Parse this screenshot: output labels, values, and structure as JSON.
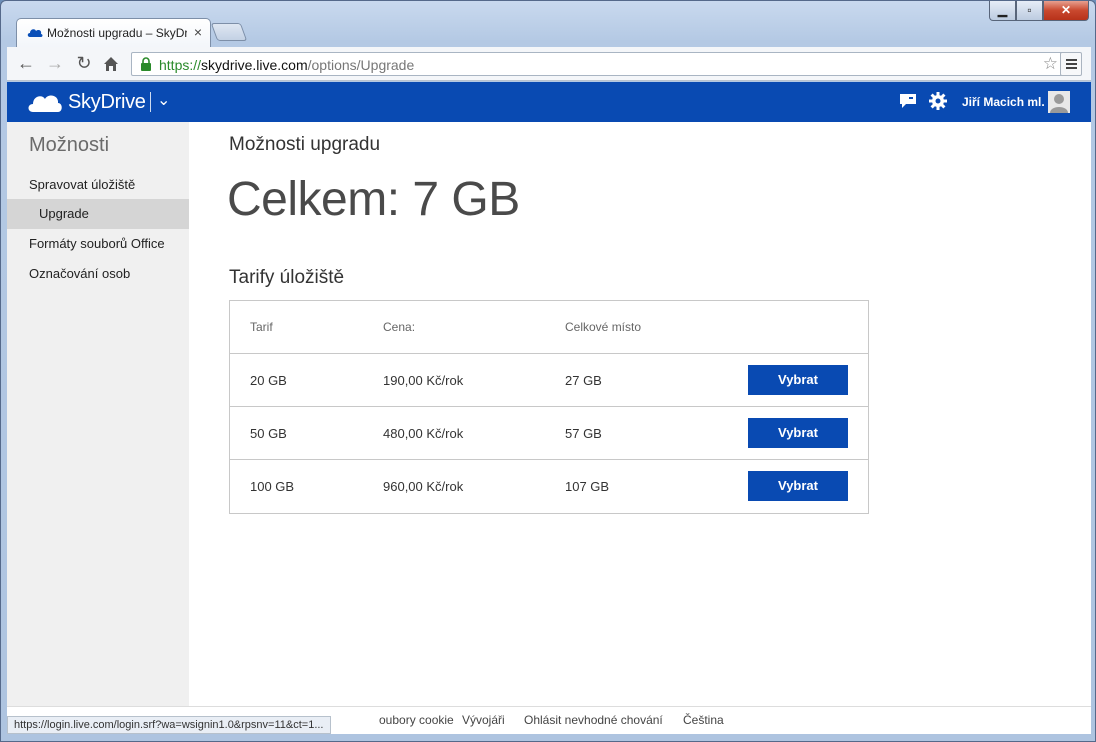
{
  "browser": {
    "tab_title": "Možnosti upgradu – SkyDrive",
    "tab_close": "×",
    "url_scheme": "https://",
    "url_host": "skydrive.live.com",
    "url_path": "/options/Upgrade",
    "status_url": "https://login.live.com/login.srf?wa=wsignin1.0&rpsnv=11&ct=1..."
  },
  "appbar": {
    "logo": "SkyDrive",
    "user_name": "Jiří Macich ml."
  },
  "sidebar": {
    "title": "Možnosti",
    "items": [
      {
        "label": "Spravovat úložiště"
      },
      {
        "label": "Upgrade"
      },
      {
        "label": "Formáty souborů Office"
      },
      {
        "label": "Označování osob"
      }
    ]
  },
  "main": {
    "heading": "Možnosti upgradu",
    "total": "Celkem: 7 GB",
    "section": "Tarify úložiště",
    "table": {
      "headers": [
        "Tarif",
        "Cena:",
        "Celkové místo"
      ],
      "rows": [
        {
          "plan": "20 GB",
          "price": "190,00 Kč/rok",
          "total": "27 GB",
          "button": "Vybrat"
        },
        {
          "plan": "50 GB",
          "price": "480,00 Kč/rok",
          "total": "57 GB",
          "button": "Vybrat"
        },
        {
          "plan": "100 GB",
          "price": "960,00 Kč/rok",
          "total": "107 GB",
          "button": "Vybrat"
        }
      ]
    }
  },
  "footer": {
    "links": [
      "oubory cookie",
      "Vývojáři",
      "Ohlásit nevhodné chování",
      "Čeština"
    ]
  },
  "colors": {
    "brand": "#094ab2",
    "sidebar_bg": "#f0f0f0",
    "active_item": "#d5d5d5"
  }
}
